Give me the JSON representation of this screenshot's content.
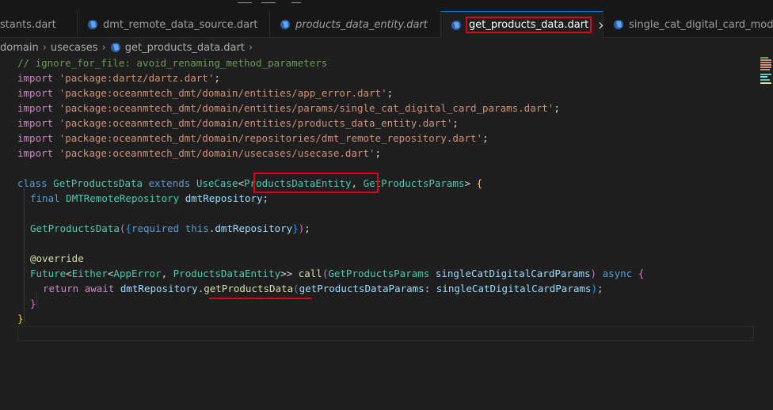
{
  "tabs": [
    {
      "label": "stants.dart",
      "italic": false,
      "active": false
    },
    {
      "label": "dmt_remote_data_source.dart",
      "italic": false,
      "active": false
    },
    {
      "label": "products_data_entity.dart",
      "italic": true,
      "active": false
    },
    {
      "label": "get_products_data.dart",
      "italic": false,
      "active": true,
      "close": "×"
    },
    {
      "label": "single_cat_digital_card_mode",
      "italic": false,
      "active": false
    }
  ],
  "breadcrumb": {
    "items": [
      "domain",
      "usecases",
      "get_products_data.dart"
    ],
    "sep": "›",
    "trail": "›"
  },
  "code": {
    "comment": "// ignore_for_file: avoid_renaming_method_parameters",
    "imports": [
      "'package:dartz/dartz.dart'",
      "'package:oceanmtech_dmt/domain/entities/app_error.dart'",
      "'package:oceanmtech_dmt/domain/entities/params/single_cat_digital_card_params.dart'",
      "'package:oceanmtech_dmt/domain/entities/products_data_entity.dart'",
      "'package:oceanmtech_dmt/domain/repositories/dmt_remote_repository.dart'",
      "'package:oceanmtech_dmt/domain/usecases/usecase.dart'"
    ],
    "kw_import": "import",
    "semi": ";",
    "kw_class": "class",
    "class_name": "GetProductsData",
    "kw_extends": "extends",
    "base": "UseCase",
    "lt": "<",
    "type_entity": "ProductsDataEntity",
    "comma": ",",
    "type_params": "GetProductsParams",
    "gt_brace": ">",
    "open_brace": "{",
    "close_brace": "}",
    "kw_final": "final",
    "repo_type": "DMTRemoteRepository",
    "repo_field": "dmtRepository",
    "ctor_name": "GetProductsData",
    "ctor_open": "(",
    "ctor_brace_open": "{",
    "kw_required": "required",
    "kw_this": "this",
    "dot": ".",
    "ctor_brace_close": "}",
    "ctor_close": ")",
    "annotation": "@override",
    "future": "Future",
    "either": "Either",
    "app_error": "AppError",
    "gtgt": ">>",
    "method": "call",
    "param_type": "GetProductsParams",
    "param_name": "singleCatDigitalCardParams",
    "kw_async": "async",
    "kw_return": "return",
    "kw_await": "await",
    "call_method": "getProductsData",
    "named_arg": "getProductsDataParams",
    "colon": ":"
  },
  "colors": {
    "accent_highlight": "#e0001b",
    "active_tab_border": "#0078d4",
    "editor_bg": "#1f1f1f"
  },
  "icons": {
    "tab_icon": "dart-file-icon",
    "close": "close-icon"
  }
}
